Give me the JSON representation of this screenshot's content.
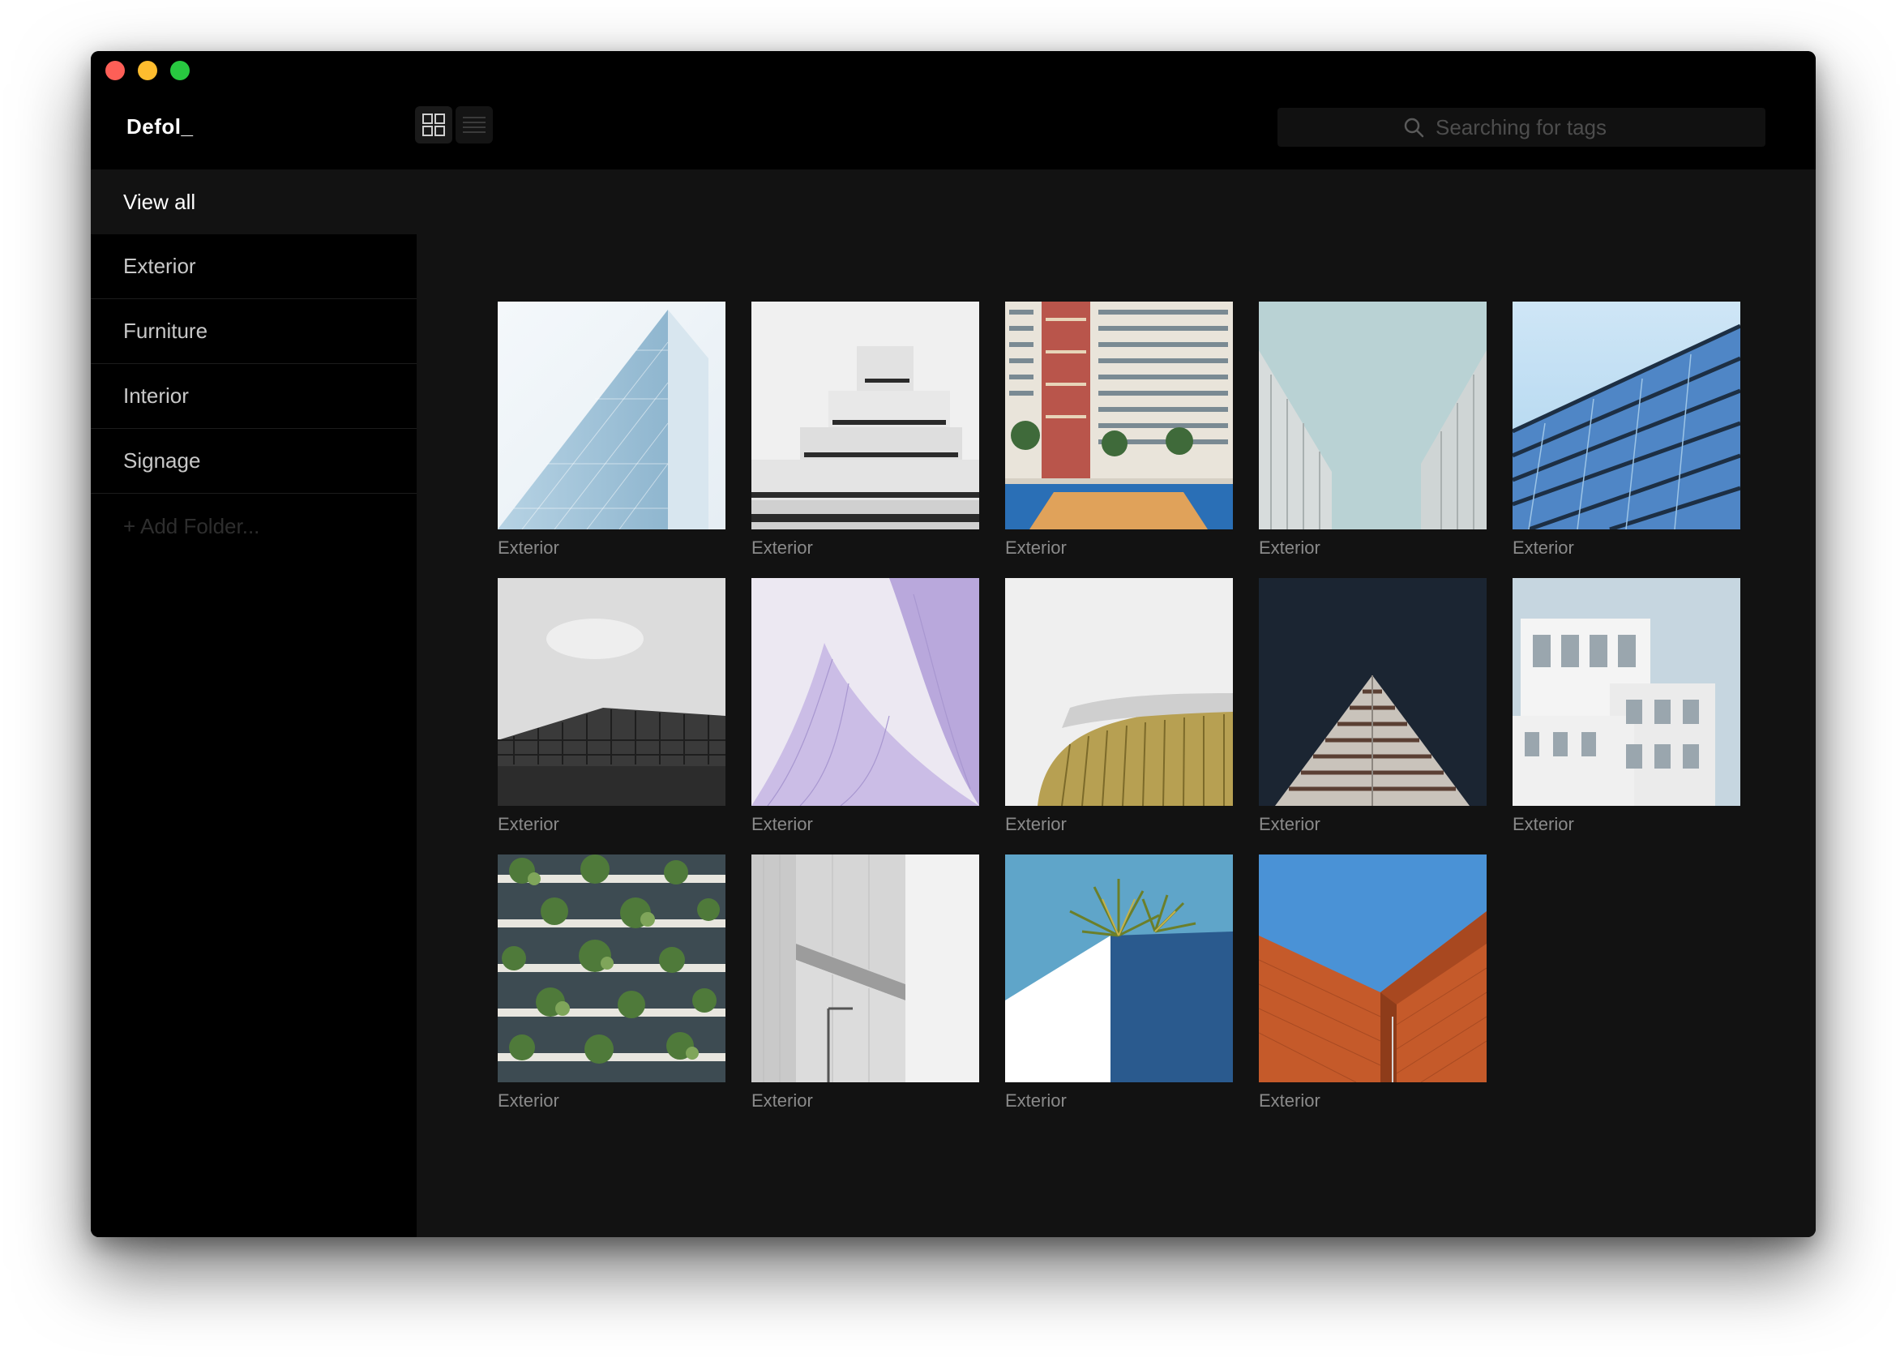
{
  "app": {
    "brand": "Defol_"
  },
  "search": {
    "placeholder": "Searching for tags"
  },
  "sidebar": {
    "items": [
      {
        "label": "View all",
        "active": true
      },
      {
        "label": "Exterior"
      },
      {
        "label": "Furniture"
      },
      {
        "label": "Interior"
      },
      {
        "label": "Signage"
      }
    ],
    "add_folder": "+ Add Folder..."
  },
  "gallery": {
    "items": [
      {
        "caption": "Exterior"
      },
      {
        "caption": "Exterior"
      },
      {
        "caption": "Exterior"
      },
      {
        "caption": "Exterior"
      },
      {
        "caption": "Exterior"
      },
      {
        "caption": "Exterior"
      },
      {
        "caption": "Exterior"
      },
      {
        "caption": "Exterior"
      },
      {
        "caption": "Exterior"
      },
      {
        "caption": "Exterior"
      },
      {
        "caption": "Exterior"
      },
      {
        "caption": "Exterior"
      },
      {
        "caption": "Exterior"
      },
      {
        "caption": "Exterior"
      }
    ]
  },
  "colors": {
    "background": "#121212",
    "sidebar": "#000000",
    "caption": "#8a8a8a",
    "active_item": "#121212"
  }
}
